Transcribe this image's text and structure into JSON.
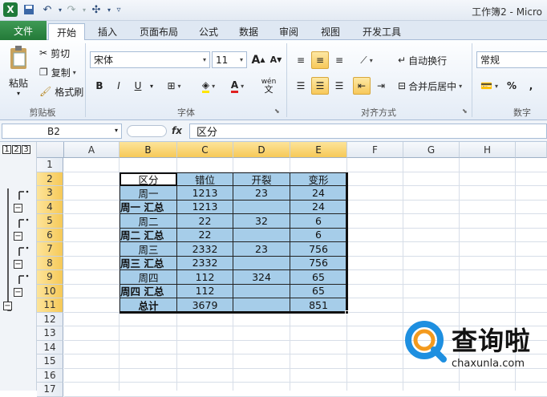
{
  "window": {
    "title": "工作簿2 - Micro"
  },
  "tabs": [
    {
      "label": "文件"
    },
    {
      "label": "开始"
    },
    {
      "label": "插入"
    },
    {
      "label": "页面布局"
    },
    {
      "label": "公式"
    },
    {
      "label": "数据"
    },
    {
      "label": "审阅"
    },
    {
      "label": "视图"
    },
    {
      "label": "开发工具"
    }
  ],
  "ribbon": {
    "clipboard": {
      "paste": "粘贴",
      "cut": "剪切",
      "copy": "复制",
      "format_painter": "格式刷",
      "group": "剪贴板"
    },
    "font": {
      "name": "宋体",
      "size": "11",
      "bold": "B",
      "italic": "I",
      "underline": "U",
      "grow": "A",
      "shrink": "A",
      "wen": "wén",
      "group": "字体"
    },
    "align": {
      "wrap": "自动换行",
      "merge": "合并后居中",
      "group": "对齐方式"
    },
    "number": {
      "format": "常规",
      "percent": "%",
      "comma": ",",
      "group": "数字"
    }
  },
  "formula_bar": {
    "name_box": "B2",
    "fx": "fx",
    "content": "区分"
  },
  "outline_levels": [
    "1",
    "2",
    "3"
  ],
  "columns": [
    "A",
    "B",
    "C",
    "D",
    "E",
    "F",
    "G",
    "H"
  ],
  "rows": [
    "1",
    "2",
    "3",
    "4",
    "5",
    "6",
    "7",
    "8",
    "9",
    "10",
    "11",
    "12",
    "13",
    "14",
    "15",
    "16",
    "17"
  ],
  "table": [
    [
      "区分",
      "错位",
      "开裂",
      "变形"
    ],
    [
      "周一",
      "1213",
      "23",
      "24"
    ],
    [
      "周一 汇总",
      "1213",
      "",
      "24"
    ],
    [
      "周二",
      "22",
      "32",
      "6"
    ],
    [
      "周二 汇总",
      "22",
      "",
      "6"
    ],
    [
      "周三",
      "2332",
      "23",
      "756"
    ],
    [
      "周三 汇总",
      "2332",
      "",
      "756"
    ],
    [
      "周四",
      "112",
      "324",
      "65"
    ],
    [
      "周四 汇总",
      "112",
      "",
      "65"
    ],
    [
      "总计",
      "3679",
      "",
      "851"
    ]
  ],
  "watermark": {
    "brand": "查询啦",
    "url": "chaxunla.com"
  },
  "colors": {
    "accent_green": "#237a38",
    "cell_blue": "#a6cde9",
    "selection": "#f6c958"
  }
}
